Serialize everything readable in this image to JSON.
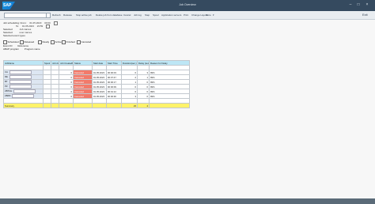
{
  "window": {
    "title": "Job Overview"
  },
  "toolbar": {
    "items": [
      "Refresh",
      "Release",
      "Stop active job",
      "Delete job from database",
      "Cancel",
      "Job log",
      "Step",
      "Spool",
      "Application servers",
      "Print",
      "Change Layout",
      "More"
    ],
    "exit": "Exit"
  },
  "header": {
    "from_label": "Job scheduling: From:",
    "from_date": "01.05.2023",
    "from_time": "00:00",
    "to_label": "To:",
    "to_date": "01.05.2023",
    "to_time": "23:59",
    "selected_label": "Selected",
    "selected_value": "Job names",
    "selected2_label": "Selected",
    "selected2_value": "user names",
    "event_label": "Selected event types",
    "status_buttons": [
      "Scheduled",
      "Released",
      "Ready",
      "Active",
      "Finished",
      "Canceled"
    ],
    "line1_a": "Event ID",
    "line1_b": "Reference",
    "line2_a": "ABAP program",
    "line2_b": "Program name"
  },
  "grid": {
    "columns": [
      "JobName",
      "Spool",
      "Job doc",
      "Job CreatedB",
      "Status",
      "Start date",
      "Start Time",
      "Duration(sec.)",
      "Delay (sec.)",
      "Reason for Delay"
    ],
    "rows": [
      {
        "name": "",
        "spool": "",
        "doc": "",
        "createdby": "",
        "status": "",
        "date": "",
        "time": "",
        "duration": "",
        "delay": "",
        "reason": ""
      },
      {
        "name": "CA",
        "spool": "",
        "doc": "",
        "createdby": "0",
        "status": "Canceled",
        "date": "01.05.2023",
        "time": "00:00:03",
        "duration": "0",
        "delay": "3",
        "reason": "99%"
      },
      {
        "name": "RE",
        "spool": "",
        "doc": "",
        "createdby": "0",
        "status": "Canceled",
        "date": "01.05.2023",
        "time": "00:07:47",
        "duration": "2",
        "delay": "1",
        "reason": "99%"
      },
      {
        "name": "BT",
        "spool": "",
        "doc": "",
        "createdby": "0",
        "status": "Canceled",
        "date": "01.05.2023",
        "time": "00:00:17",
        "duration": "1",
        "delay": "0",
        "reason": "99%"
      },
      {
        "name": "PZ",
        "spool": "",
        "doc": "",
        "createdby": "0",
        "status": "Canceled",
        "date": "01.05.2023",
        "time": "00:00:09",
        "duration": "0",
        "delay": "0",
        "reason": "99%"
      },
      {
        "name": "ZBTCH",
        "spool": "",
        "doc": "",
        "createdby": "0",
        "status": "Canceled",
        "date": "01.05.2023",
        "time": "00:01:12",
        "duration": "0",
        "delay": "0",
        "reason": "99%"
      },
      {
        "name": "ZBPR",
        "spool": "",
        "doc": "",
        "createdby": "0",
        "status": "Canceled",
        "date": "01.05.2023",
        "time": "00:00:30",
        "duration": "3",
        "delay": "0",
        "reason": "99%"
      },
      {
        "name": "",
        "spool": "",
        "doc": "",
        "createdby": "",
        "status": "",
        "date": "",
        "time": "",
        "duration": "",
        "delay": "",
        "reason": ""
      }
    ],
    "summary": {
      "label": "Summary",
      "duration": "23",
      "delay": "4"
    }
  },
  "colors": {
    "shell": "#354a5f",
    "header_cell": "#bde6f5",
    "canceled": "#f27a6a",
    "summary": "#fff36b"
  }
}
